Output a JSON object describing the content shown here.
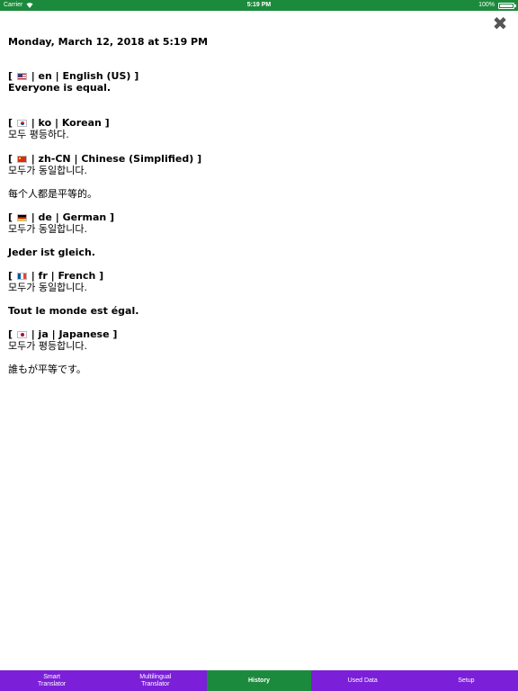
{
  "status_bar": {
    "carrier": "Carrier",
    "time": "5:19 PM",
    "battery": "100%"
  },
  "colors": {
    "status_green": "#1c8a3c",
    "tab_purple": "#7b1fd8",
    "active_tab_green": "#1c8a3c"
  },
  "close_icon": "✖",
  "history": {
    "date": "Monday, March 12, 2018 at 5:19 PM",
    "entries": [
      {
        "code": "en",
        "language": "English (US)",
        "flag": "us-flag-icon",
        "lines": [
          "Everyone is equal."
        ],
        "bold": true
      },
      {
        "code": "ko",
        "language": "Korean",
        "flag": "kr-flag-icon",
        "lines": [
          "모두 평등하다."
        ]
      },
      {
        "code": "zh-CN",
        "language": "Chinese (Simplified)",
        "flag": "cn-flag-icon",
        "lines": [
          "모두가 동일합니다.",
          "每个人都是平等的。"
        ]
      },
      {
        "code": "de",
        "language": "German",
        "flag": "de-flag-icon",
        "lines": [
          "모두가 동일합니다.",
          "Jeder ist gleich."
        ]
      },
      {
        "code": "fr",
        "language": "French",
        "flag": "fr-flag-icon",
        "lines": [
          "모두가 동일합니다.",
          "Tout le monde est égal."
        ]
      },
      {
        "code": "ja",
        "language": "Japanese",
        "flag": "jp-flag-icon",
        "lines": [
          "모두가 평등합니다.",
          "誰もが平等です。"
        ]
      }
    ]
  },
  "tabs": [
    {
      "label": "Smart\nTranslator",
      "active": false
    },
    {
      "label": "Multilingual\nTranslator",
      "active": false
    },
    {
      "label": "History",
      "active": true
    },
    {
      "label": "Used Data",
      "active": false
    },
    {
      "label": "Setup",
      "active": false
    }
  ]
}
